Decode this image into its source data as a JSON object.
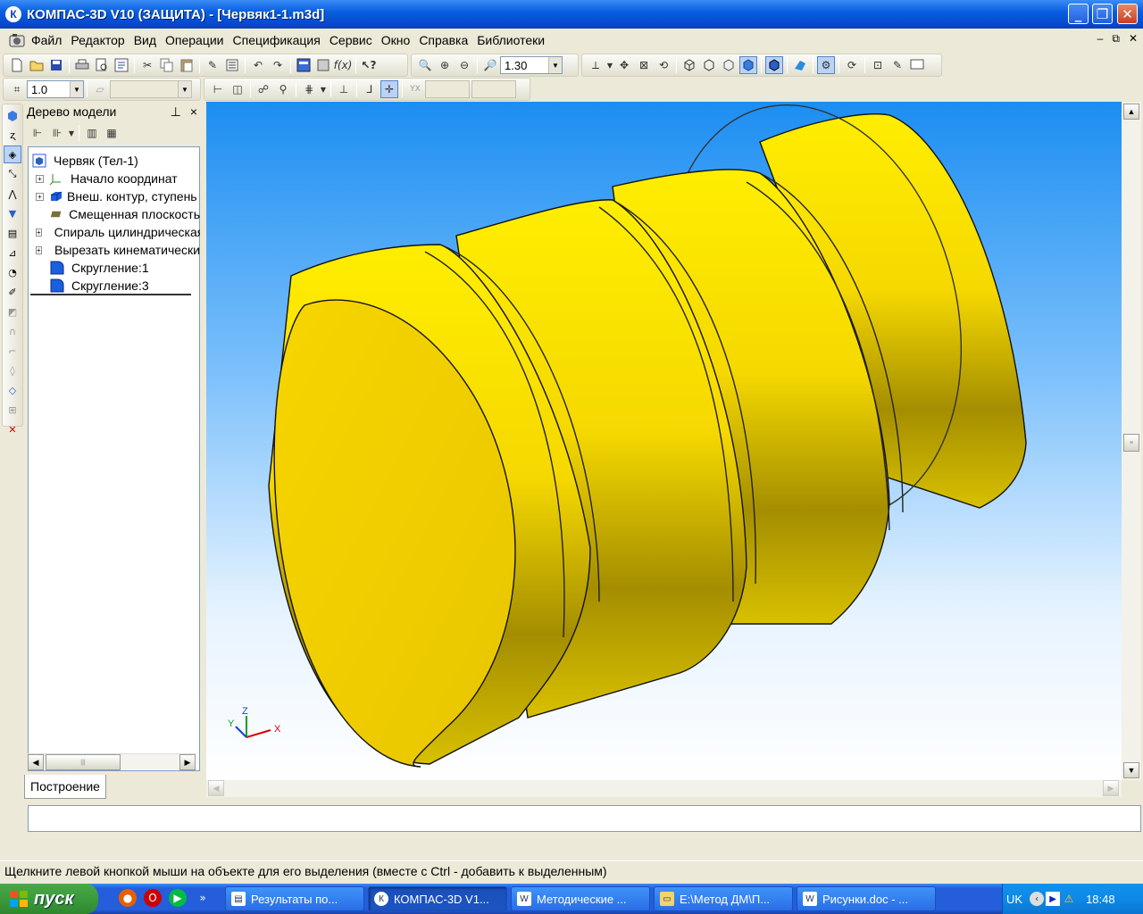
{
  "window": {
    "title": "КОМПАС-3D V10 (ЗАЩИТА) - [Червяк1-1.m3d]",
    "app_icon": "К",
    "minimize": "_",
    "restore": "❐",
    "close": "✕"
  },
  "menu": {
    "items": [
      "Файл",
      "Редактор",
      "Вид",
      "Операции",
      "Спецификация",
      "Сервис",
      "Окно",
      "Справка",
      "Библиотеки"
    ],
    "doc_controls": [
      "–",
      "⧉",
      "✕"
    ]
  },
  "toolbar1": {
    "zoom_value": "1.30"
  },
  "toolbar2": {
    "step_value": "1.0",
    "layer_value": "",
    "x_value": "",
    "y_value": ""
  },
  "tree": {
    "title": "Дерево модели",
    "pin": "⊥",
    "close": "×",
    "nodes": [
      {
        "label": "Червяк (Тел-1)",
        "icon": "part-icon",
        "expand": false
      },
      {
        "label": "Начало координат",
        "icon": "origin-icon",
        "expand": true
      },
      {
        "label": "Внеш. контур, ступень",
        "icon": "extrude-icon",
        "expand": true
      },
      {
        "label": "Смещенная плоскость",
        "icon": "plane-icon",
        "expand": false
      },
      {
        "label": "Спираль цилиндрическая",
        "icon": "spiral-icon",
        "expand": true
      },
      {
        "label": "Вырезать кинематически",
        "icon": "cut-icon",
        "expand": true
      },
      {
        "label": "Скругление:1",
        "icon": "fillet-icon",
        "expand": false
      },
      {
        "label": "Скругление:3",
        "icon": "fillet-icon",
        "expand": false
      }
    ],
    "scroll_left": "◀",
    "scroll_right": "▶",
    "scroll_grip": "|||"
  },
  "tabs": {
    "build": "Построение"
  },
  "axes": {
    "x": "X",
    "y": "Y",
    "z": "Z"
  },
  "status": {
    "text": "Щелкните левой кнопкой мыши на объекте для его выделения (вместе с Ctrl - добавить к выделенным)"
  },
  "taskbar": {
    "start": "пуск",
    "tasks": [
      {
        "label": "Результаты по...",
        "icon": "doc-icon"
      },
      {
        "label": "КОМПАС-3D V1...",
        "icon": "kompas-icon",
        "active": true
      },
      {
        "label": "Методические ...",
        "icon": "word-icon"
      },
      {
        "label": "E:\\Метод ДМ\\П...",
        "icon": "folder-icon"
      },
      {
        "label": "Рисунки.doc - ...",
        "icon": "word-icon"
      }
    ],
    "more": "»",
    "lang": "UK",
    "clock": "18:48"
  },
  "colors": {
    "model_yellow": "#ffee00",
    "viewport_top": "#1c8ef2",
    "titlebar": "#0a5fe0"
  }
}
